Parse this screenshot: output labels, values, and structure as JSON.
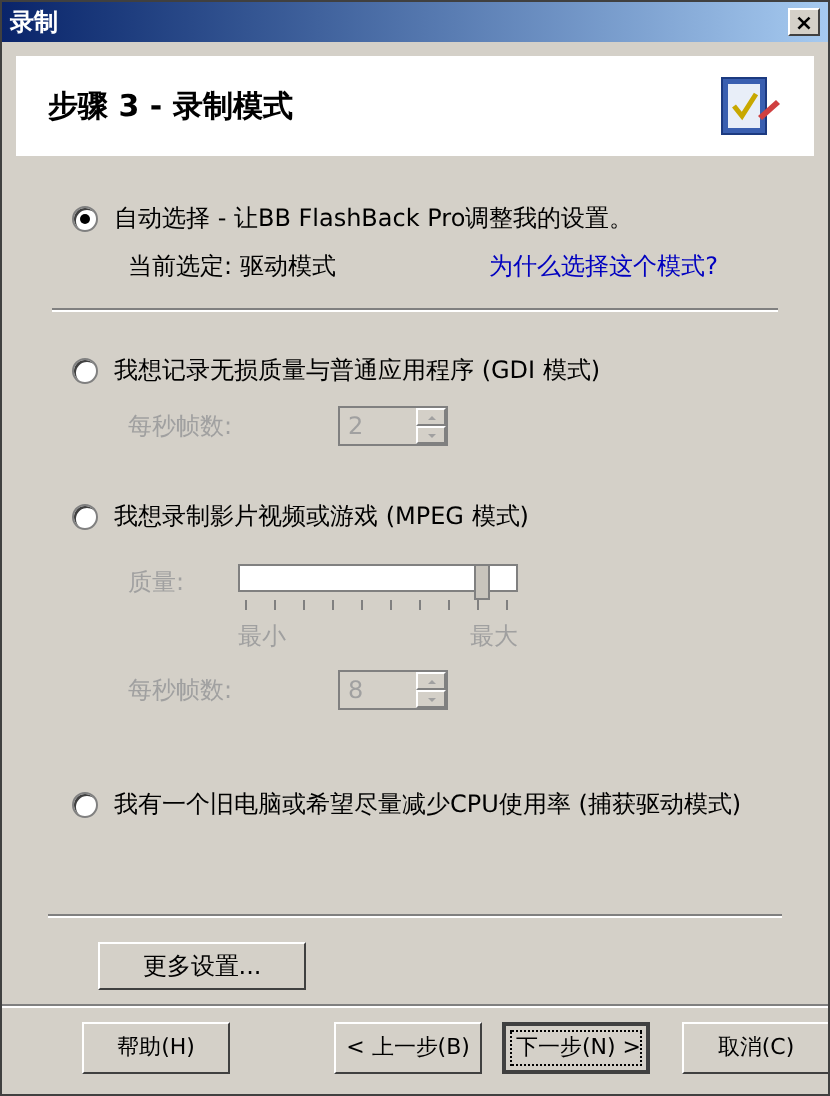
{
  "window": {
    "title": "录制",
    "close": "×"
  },
  "header": {
    "title": "步骤 3 - 录制模式"
  },
  "auto": {
    "label": "自动选择 - 让BB FlashBack Pro调整我的设置。",
    "selected": true,
    "current": "当前选定: 驱动模式",
    "link": "为什么选择这个模式?"
  },
  "gdi": {
    "label": "我想记录无损质量与普通应用程序 (GDI 模式)",
    "selected": false,
    "fps_label": "每秒帧数:",
    "fps": "2",
    "disabled": true
  },
  "mpeg": {
    "label": "我想录制影片视频或游戏 (MPEG 模式)",
    "selected": false,
    "quality_label": "质量:",
    "quality": {
      "level": 0.88,
      "min": "最小",
      "max": "最大"
    },
    "fps_label": "每秒帧数:",
    "fps": "8",
    "disabled": true
  },
  "driver": {
    "label": "我有一个旧电脑或希望尽量减少CPU使用率 (捕获驱动模式)",
    "selected": false
  },
  "more_button": "更多设置...",
  "buttons": [
    {
      "label": "帮助(H)",
      "focused": false
    },
    {
      "label": "< 上一步(B)",
      "focused": false
    },
    {
      "label": "下一步(N) >",
      "focused": true
    },
    {
      "label": "取消(C)",
      "focused": false
    }
  ]
}
